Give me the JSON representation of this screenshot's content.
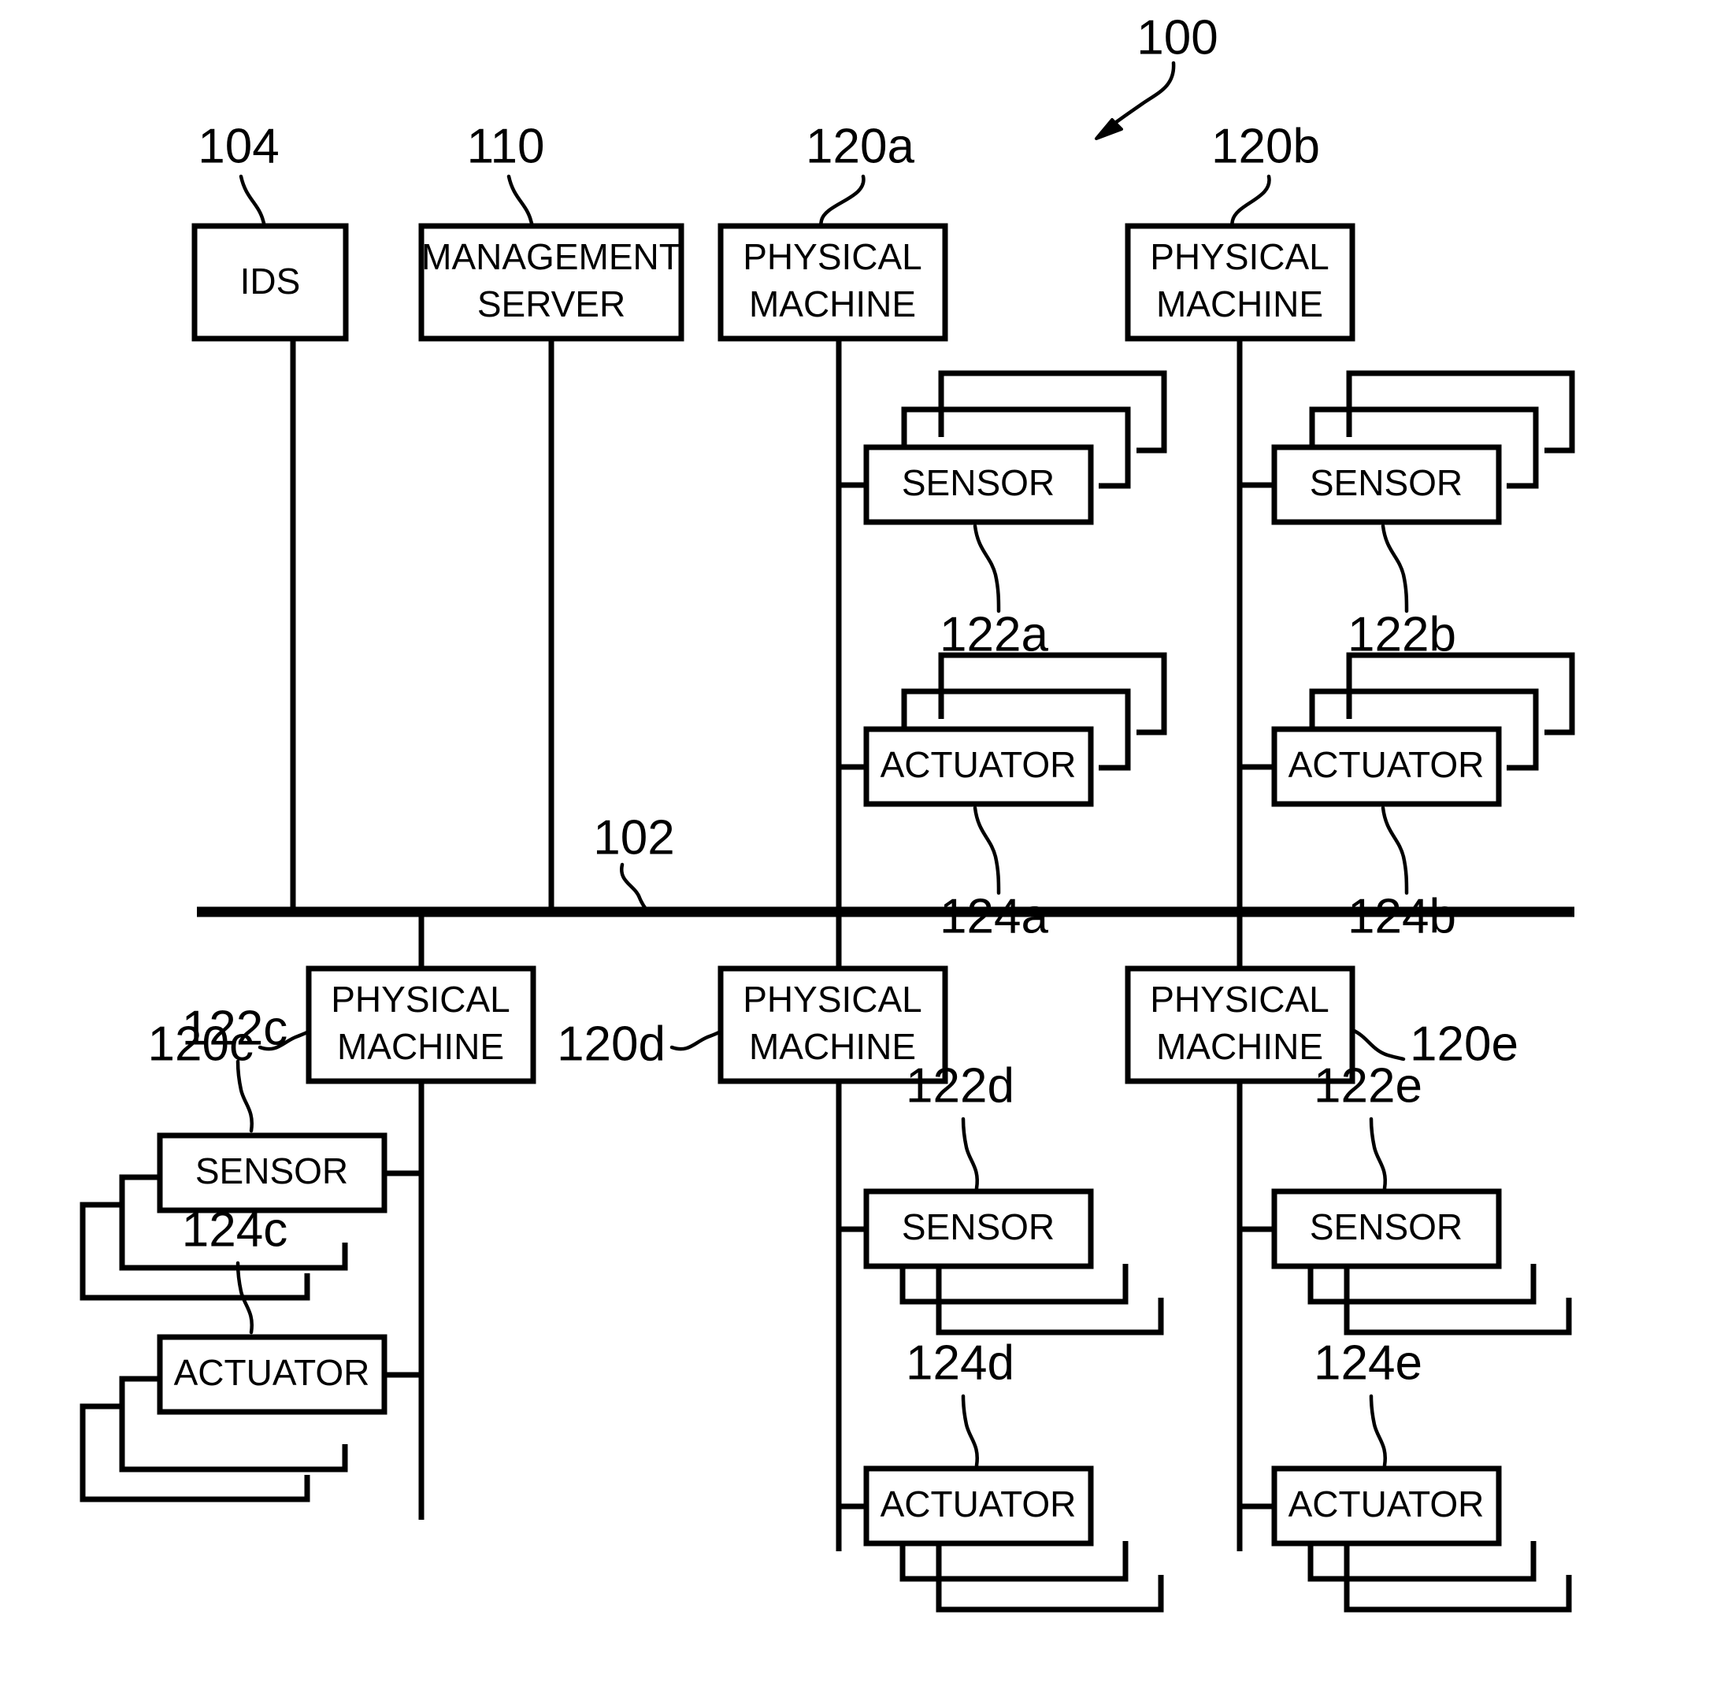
{
  "figure": {
    "figure_ref": "100",
    "bus_ref": "102",
    "background_color": "#ffffff",
    "line_color": "#000000"
  },
  "nodes": {
    "ids": {
      "label": "IDS",
      "ref": "104"
    },
    "management_server": {
      "label_line1": "MANAGEMENT",
      "label_line2": "SERVER",
      "ref": "110"
    },
    "pm_a": {
      "label_line1": "PHYSICAL",
      "label_line2": "MACHINE",
      "ref": "120a"
    },
    "pm_b": {
      "label_line1": "PHYSICAL",
      "label_line2": "MACHINE",
      "ref": "120b"
    },
    "pm_c": {
      "label_line1": "PHYSICAL",
      "label_line2": "MACHINE",
      "ref": "120c"
    },
    "pm_d": {
      "label_line1": "PHYSICAL",
      "label_line2": "MACHINE",
      "ref": "120d"
    },
    "pm_e": {
      "label_line1": "PHYSICAL",
      "label_line2": "MACHINE",
      "ref": "120e"
    },
    "sensor_a": {
      "label": "SENSOR",
      "ref": "122a"
    },
    "sensor_b": {
      "label": "SENSOR",
      "ref": "122b"
    },
    "sensor_c": {
      "label": "SENSOR",
      "ref": "122c"
    },
    "sensor_d": {
      "label": "SENSOR",
      "ref": "122d"
    },
    "sensor_e": {
      "label": "SENSOR",
      "ref": "122e"
    },
    "actuator_a": {
      "label": "ACTUATOR",
      "ref": "124a"
    },
    "actuator_b": {
      "label": "ACTUATOR",
      "ref": "124b"
    },
    "actuator_c": {
      "label": "ACTUATOR",
      "ref": "124c"
    },
    "actuator_d": {
      "label": "ACTUATOR",
      "ref": "124d"
    },
    "actuator_e": {
      "label": "ACTUATOR",
      "ref": "124e"
    }
  }
}
